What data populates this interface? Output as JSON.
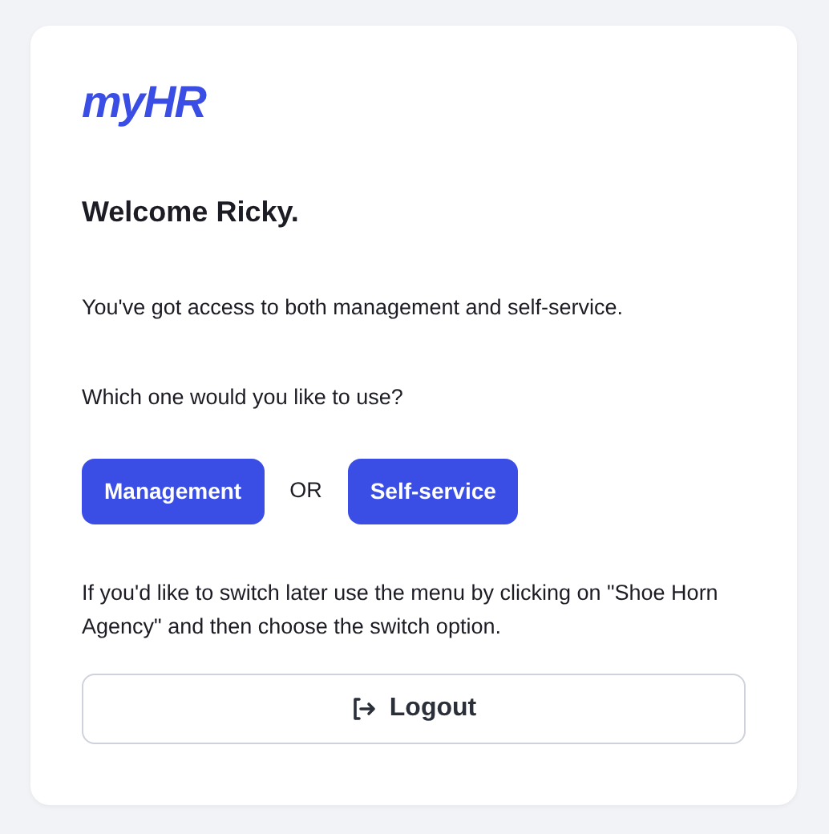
{
  "logo": "myHR",
  "heading": "Welcome Ricky.",
  "access_text": "You've got access to both management and self-service.",
  "question": "Which one would you like to use?",
  "choices": [
    {
      "label": "Management"
    },
    {
      "label": "Self-service"
    }
  ],
  "separator": "OR",
  "hint": "If you'd like to switch later use the menu by clicking on \"Shoe Horn Agency\" and then choose the switch option.",
  "logout_button": "Logout"
}
